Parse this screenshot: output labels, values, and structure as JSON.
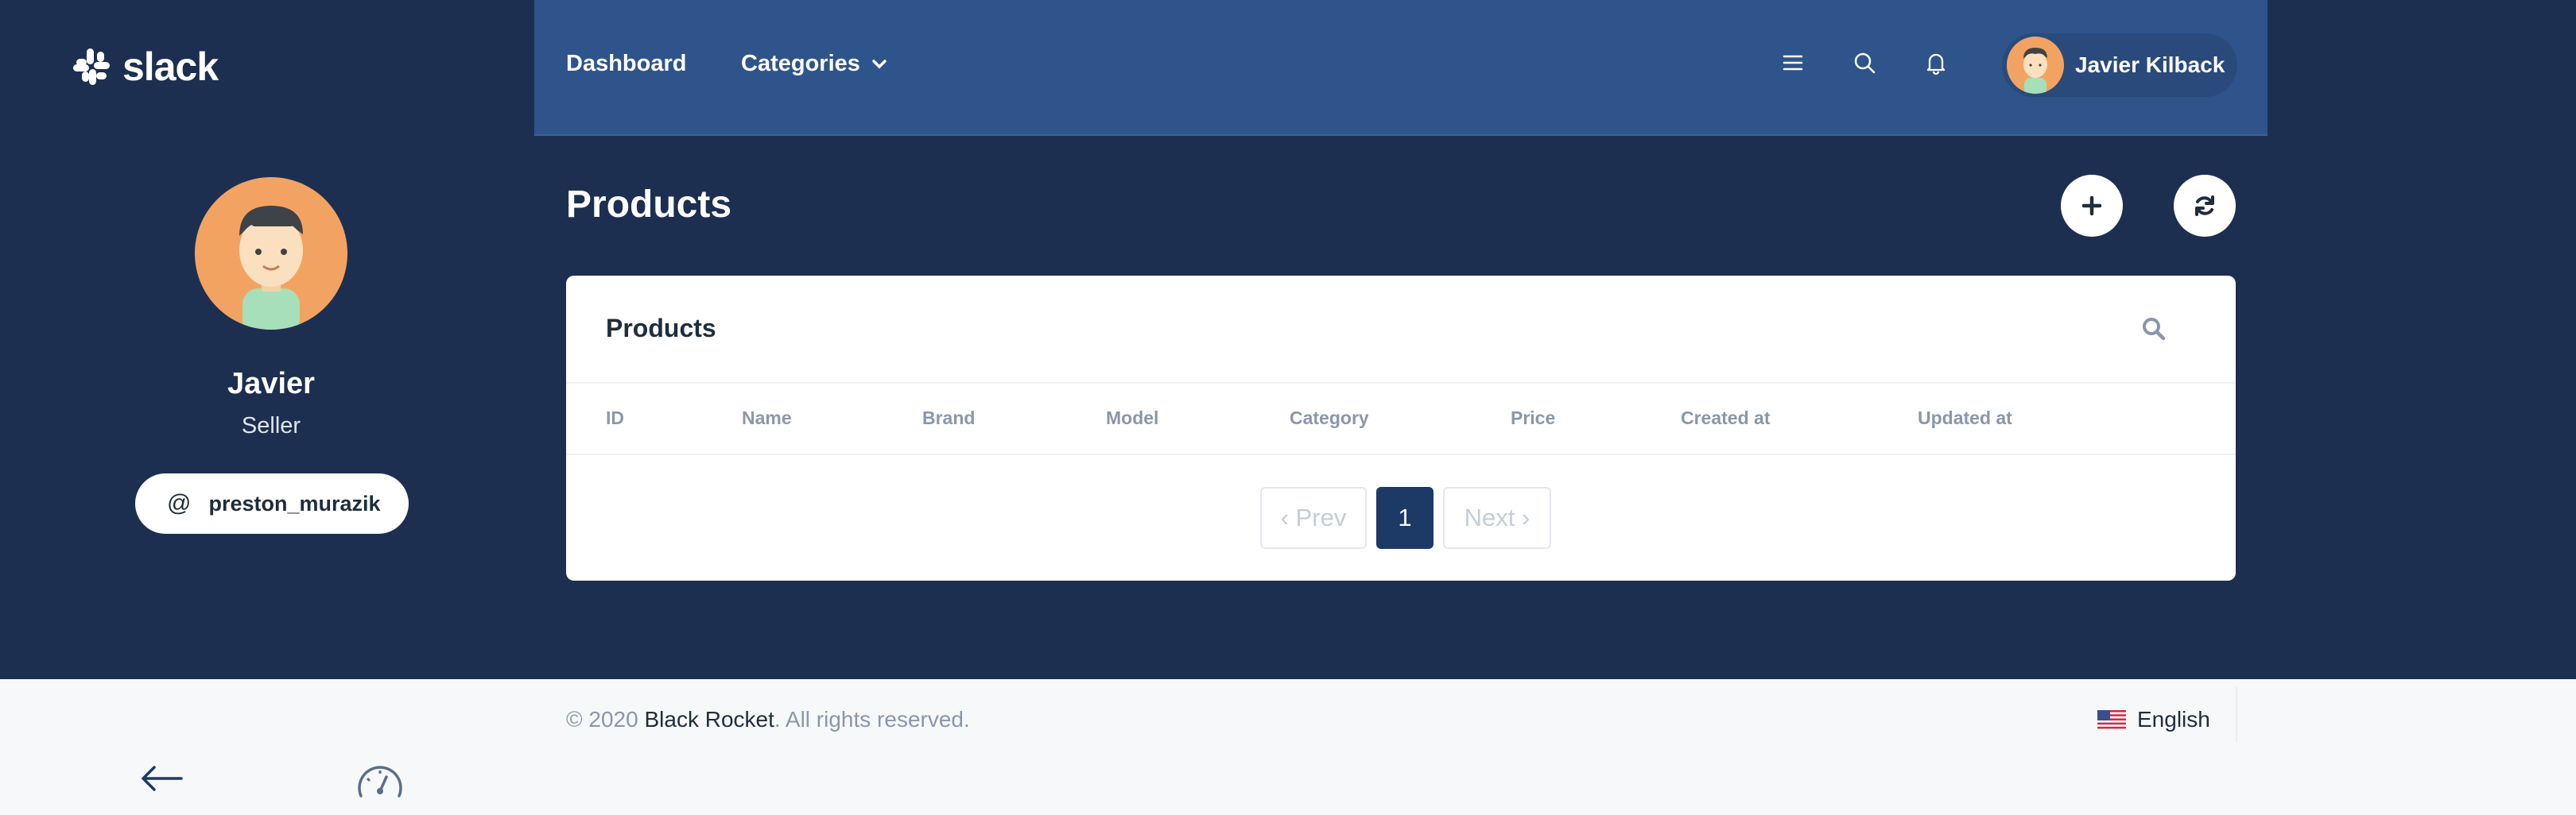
{
  "brand": {
    "logo_text": "slack"
  },
  "sidebar": {
    "profile_name": "Javier",
    "profile_role": "Seller",
    "handle": "preston_murazik",
    "handle_prefix": "@"
  },
  "nav": {
    "dashboard": "Dashboard",
    "categories": "Categories",
    "user_name": "Javier Kilback",
    "icons": [
      "menu-icon",
      "search-icon",
      "bell-icon"
    ]
  },
  "page": {
    "title": "Products"
  },
  "card": {
    "title": "Products",
    "columns": [
      "ID",
      "Name",
      "Brand",
      "Model",
      "Category",
      "Price",
      "Created at",
      "Updated at"
    ],
    "rows": []
  },
  "pagination": {
    "prev": "‹ Prev",
    "current": "1",
    "next": "Next ›"
  },
  "footer": {
    "copyright_prefix": "© 2020 ",
    "company": "Black Rocket",
    "copyright_suffix": ". All rights reserved.",
    "language": "English"
  },
  "colors": {
    "dark_bg": "#1d2f50",
    "nav_bg": "#2f548c",
    "accent": "#1d3a66",
    "avatar_bg": "#f3a361"
  }
}
